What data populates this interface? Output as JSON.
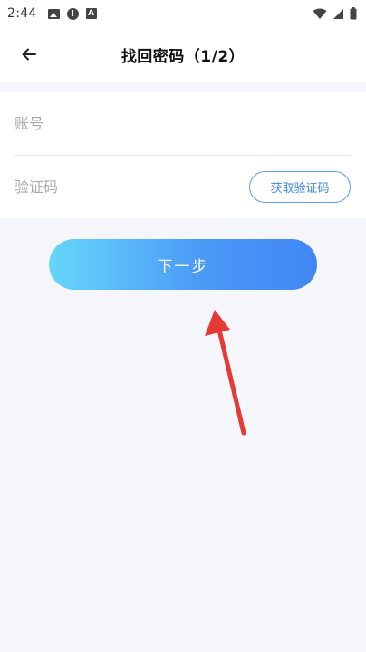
{
  "status_bar": {
    "time": "2:44",
    "icons": [
      "image-icon",
      "alert-icon",
      "a-badge-icon",
      "wifi-icon",
      "signal-icon",
      "battery-icon"
    ]
  },
  "header": {
    "back_icon": "arrow-left-icon",
    "title": "找回密码（1/2）"
  },
  "form": {
    "account_placeholder": "账号",
    "account_value": "",
    "code_placeholder": "验证码",
    "code_value": "",
    "get_code_label": "获取验证码"
  },
  "next_button": {
    "label": "下一步"
  },
  "colors": {
    "accent": "#4186f4",
    "gradient_start": "#66d6fb",
    "gradient_end": "#4186f4",
    "background": "#f5f6fb",
    "annotation_arrow": "#e53935"
  }
}
